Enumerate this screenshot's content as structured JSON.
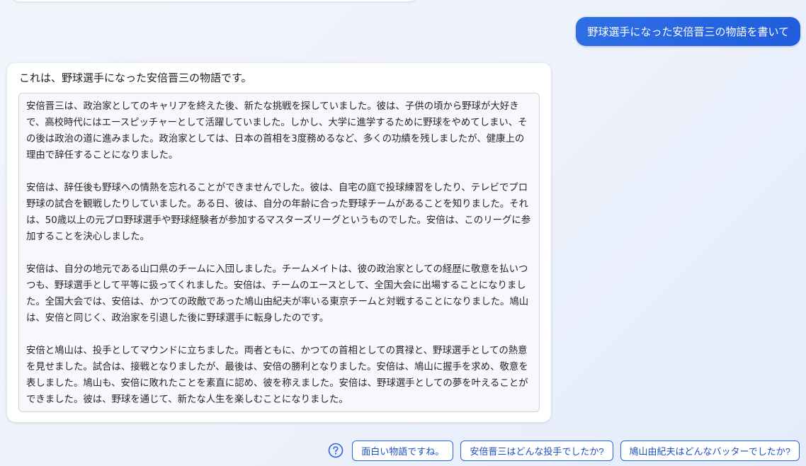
{
  "conversation": {
    "user_message": "野球選手になった安倍晋三の物語を書いて",
    "bot_intro": "これは、野球選手になった安倍晋三の物語です。",
    "story_paragraphs": [
      "安倍晋三は、政治家としてのキャリアを終えた後、新たな挑戦を探していました。彼は、子供の頃から野球が大好きで、高校時代にはエースピッチャーとして活躍していました。しかし、大学に進学するために野球をやめてしまい、その後は政治の道に進みました。政治家としては、日本の首相を3度務めるなど、多くの功績を残しましたが、健康上の理由で辞任することになりました。",
      "安倍は、辞任後も野球への情熱を忘れることができませんでした。彼は、自宅の庭で投球練習をしたり、テレビでプロ野球の試合を観戦したりしていました。ある日、彼は、自分の年齢に合った野球チームがあることを知りました。それは、50歳以上の元プロ野球選手や野球経験者が参加するマスターズリーグというものでした。安倍は、このリーグに参加することを決心しました。",
      "安倍は、自分の地元である山口県のチームに入団しました。チームメイトは、彼の政治家としての経歴に敬意を払いつつも、野球選手として平等に扱ってくれました。安倍は、チームのエースとして、全国大会に出場することになりました。全国大会では、安倍は、かつての政敵であった鳩山由紀夫が率いる東京チームと対戦することになりました。鳩山は、安倍と同じく、政治家を引退した後に野球選手に転身したのです。",
      "安倍と鳩山は、投手としてマウンドに立ちました。両者ともに、かつての首相としての貫禄と、野球選手としての熱意を見せました。試合は、接戦となりましたが、最後は、安倍の勝利となりました。安倍は、鳩山に握手を求め、敬意を表しました。鳩山も、安倍に敗れたことを素直に認め、彼を称えました。安倍は、野球選手としての夢を叶えることができました。彼は、野球を通じて、新たな人生を楽しむことになりました。"
    ]
  },
  "suggestions": {
    "icon": "help-icon",
    "items": [
      "面白い物語ですね。",
      "安倍晋三はどんな投手でしたか?",
      "鳩山由紀夫はどんなバッターでしたか?"
    ]
  },
  "colors": {
    "user_bubble": "#2563e0",
    "chip_border": "#2b63d9",
    "chip_text": "#1a4fbf"
  }
}
